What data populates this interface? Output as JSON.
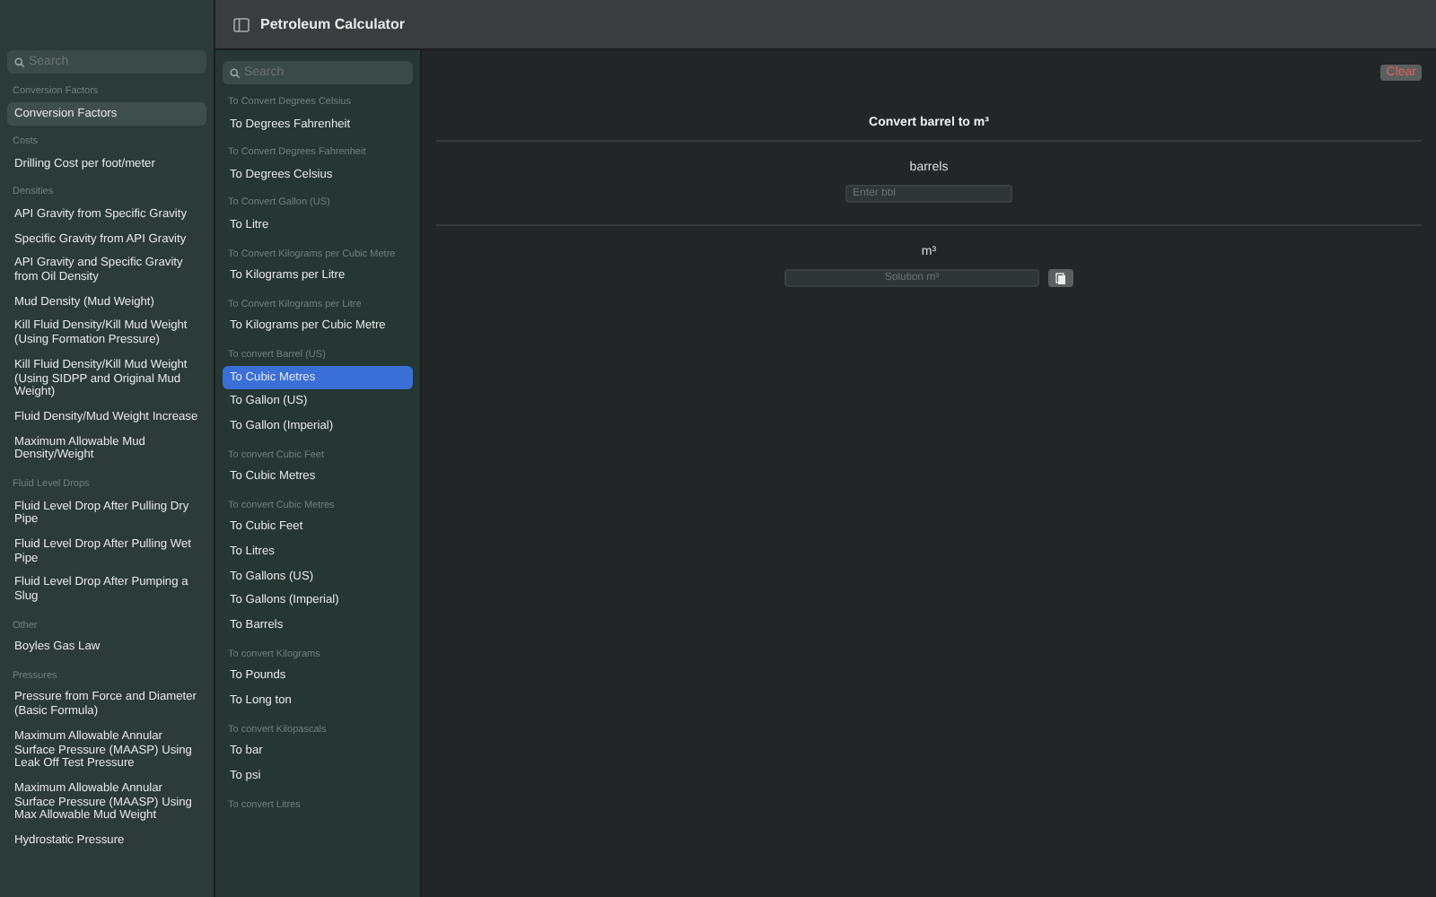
{
  "window": {
    "title": "Petroleum Calculator"
  },
  "sidebar": {
    "search": {
      "placeholder": "Search"
    },
    "sections": [
      {
        "header": "Conversion Factors",
        "items": [
          {
            "label": "Conversion Factors",
            "selected": true
          }
        ]
      },
      {
        "header": "Costs",
        "items": [
          {
            "label": "Drilling Cost per foot/meter",
            "selected": false
          }
        ]
      },
      {
        "header": "Densities",
        "items": [
          {
            "label": "API Gravity from Specific Gravity",
            "selected": false
          },
          {
            "label": "Specific Gravity from API Gravity",
            "selected": false
          },
          {
            "label": "API Gravity and Specific Gravity from Oil Density",
            "selected": false
          },
          {
            "label": "Mud Density (Mud Weight)",
            "selected": false
          },
          {
            "label": "Kill Fluid Density/Kill Mud Weight (Using Formation Pressure)",
            "selected": false
          },
          {
            "label": "Kill Fluid Density/Kill Mud Weight (Using SIDPP and Original Mud Weight)",
            "selected": false
          },
          {
            "label": "Fluid Density/Mud Weight Increase",
            "selected": false
          },
          {
            "label": "Maximum Allowable Mud Density/Weight",
            "selected": false
          }
        ]
      },
      {
        "header": "Fluid Level Drops",
        "items": [
          {
            "label": "Fluid Level Drop After Pulling Dry Pipe",
            "selected": false
          },
          {
            "label": "Fluid Level Drop After Pulling Wet Pipe",
            "selected": false
          },
          {
            "label": "Fluid Level Drop After Pumping a Slug",
            "selected": false
          }
        ]
      },
      {
        "header": "Other",
        "items": [
          {
            "label": "Boyles Gas Law",
            "selected": false
          }
        ]
      },
      {
        "header": "Pressures",
        "items": [
          {
            "label": "Pressure from Force and Diameter (Basic Formula)",
            "selected": false
          },
          {
            "label": "Maximum Allowable Annular Surface Pressure (MAASP) Using Leak Off Test Pressure",
            "selected": false
          },
          {
            "label": "Maximum Allowable Annular Surface Pressure (MAASP) Using Max Allowable Mud Weight",
            "selected": false
          },
          {
            "label": "Hydrostatic Pressure",
            "selected": false
          }
        ]
      }
    ]
  },
  "list": {
    "search": {
      "placeholder": "Search"
    },
    "sections": [
      {
        "header": "To Convert Degrees Celsius",
        "items": [
          {
            "label": "To Degrees Fahrenheit",
            "selected": false
          }
        ]
      },
      {
        "header": "To Convert Degrees Fahrenheit",
        "items": [
          {
            "label": "To Degrees Celsius",
            "selected": false
          }
        ]
      },
      {
        "header": "To Convert Gallon (US)",
        "items": [
          {
            "label": "To Litre",
            "selected": false
          }
        ]
      },
      {
        "header": "To Convert Kilograms per Cubic Metre",
        "items": [
          {
            "label": "To Kilograms per Litre",
            "selected": false
          }
        ]
      },
      {
        "header": "To Convert Kilograms per Litre",
        "items": [
          {
            "label": "To Kilograms per Cubic Metre",
            "selected": false
          }
        ]
      },
      {
        "header": "To convert Barrel (US)",
        "items": [
          {
            "label": "To Cubic Metres",
            "selected": true
          },
          {
            "label": "To Gallon (US)",
            "selected": false
          },
          {
            "label": "To Gallon (Imperial)",
            "selected": false
          }
        ]
      },
      {
        "header": "To convert Cubic Feet",
        "items": [
          {
            "label": "To Cubic Metres",
            "selected": false
          }
        ]
      },
      {
        "header": "To convert Cubic Metres",
        "items": [
          {
            "label": "To Cubic Feet",
            "selected": false
          },
          {
            "label": "To Litres",
            "selected": false
          },
          {
            "label": "To Gallons (US)",
            "selected": false
          },
          {
            "label": "To Gallons (Imperial)",
            "selected": false
          },
          {
            "label": "To Barrels",
            "selected": false
          }
        ]
      },
      {
        "header": "To convert Kilograms",
        "items": [
          {
            "label": "To Pounds",
            "selected": false
          },
          {
            "label": "To Long ton",
            "selected": false
          }
        ]
      },
      {
        "header": "To convert Kilopascals",
        "items": [
          {
            "label": "To bar",
            "selected": false
          },
          {
            "label": "To psi",
            "selected": false
          }
        ]
      },
      {
        "header": "To convert Litres"
      }
    ]
  },
  "detail": {
    "clear_button": "Clear",
    "title": "Convert barrel to m³",
    "input": {
      "label": "barrels",
      "placeholder": "Enter bbl"
    },
    "output": {
      "label": "m³",
      "placeholder": "Solution m³"
    }
  }
}
